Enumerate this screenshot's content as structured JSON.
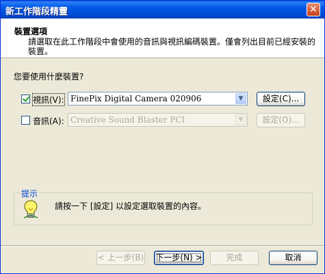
{
  "window": {
    "title": "新工作階段精靈",
    "close": "✕"
  },
  "header": {
    "title": "裝置選項",
    "description": "請選取在此工作階段中會使用的音訊與視訊編碼裝置。僅會列出目前已經安裝的裝置。"
  },
  "question": "您要使用什麼裝置?",
  "devices": {
    "video": {
      "label": "視訊(V):",
      "checked": true,
      "value": "FinePix Digital Camera 020906",
      "settings": "設定(C)...",
      "enabled": true
    },
    "audio": {
      "label": "音訊(A):",
      "checked": false,
      "value": "Creative Sound Blaster PCI",
      "settings": "設定(O)...",
      "enabled": false
    }
  },
  "hint": {
    "legend": "提示",
    "text": "請按一下 [設定] 以設定選取裝置的內容。",
    "icon": "lightbulb-icon"
  },
  "footer": {
    "back": "< 上一步(B)",
    "next": "下一步(N) >",
    "finish": "完成",
    "cancel": "取消"
  },
  "colors": {
    "titlebar": "#0058e6",
    "dialog_bg": "#ece9d8",
    "hint_legend": "#0046d5",
    "button_border": "#003c74"
  }
}
